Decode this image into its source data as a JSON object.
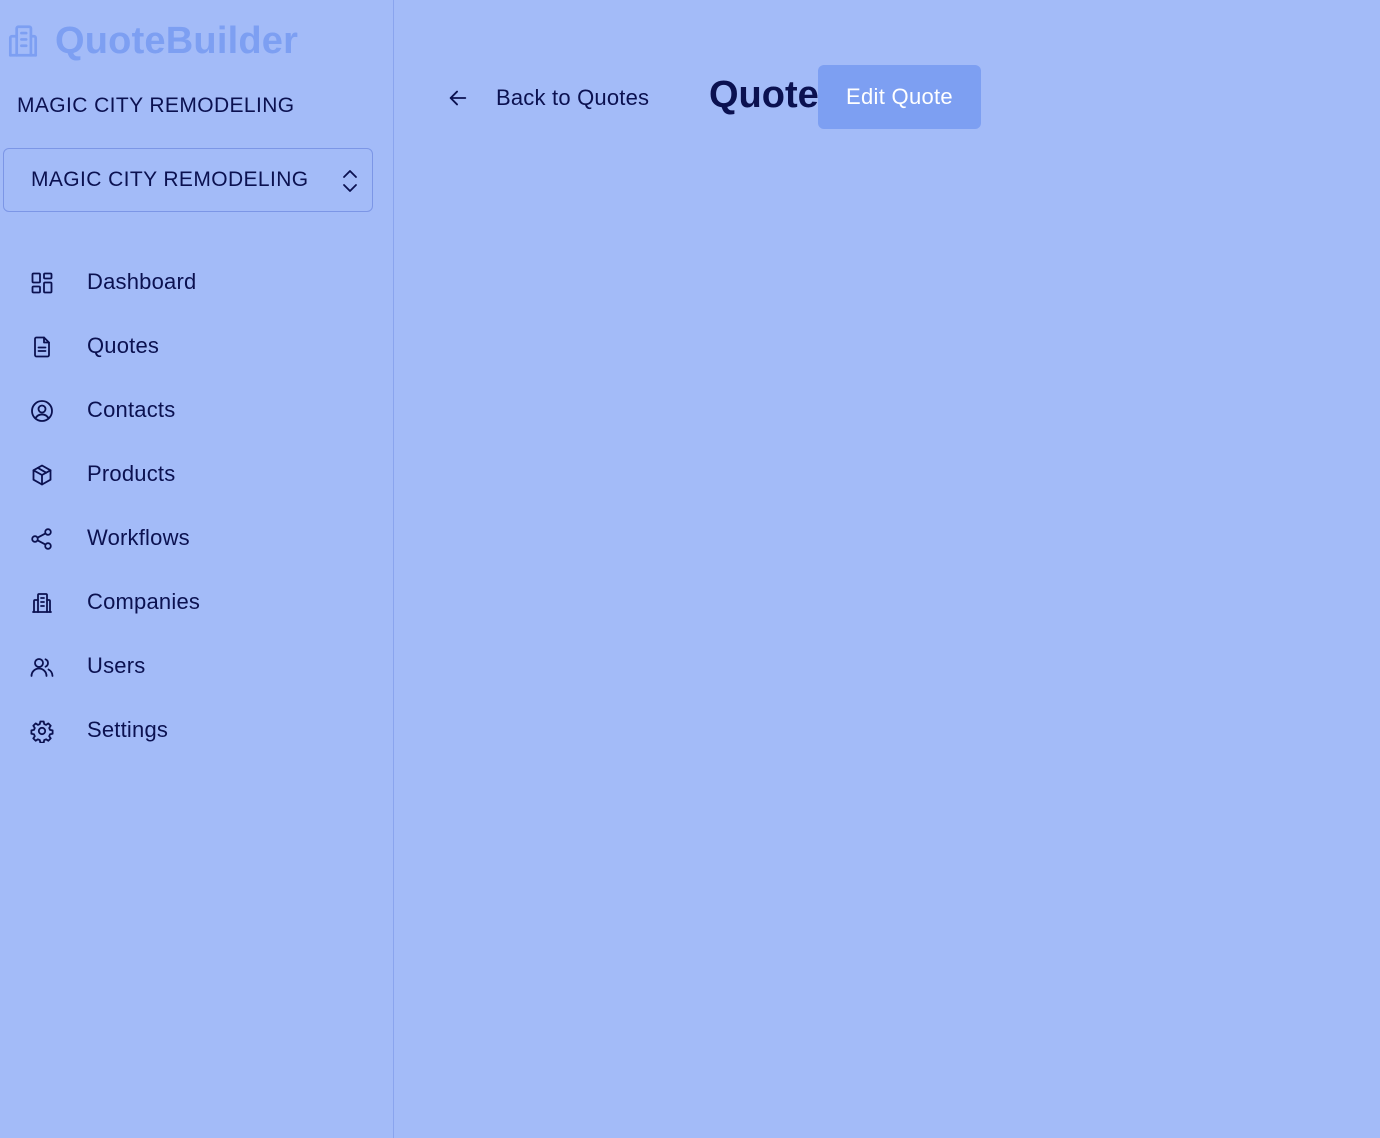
{
  "brand": {
    "name": "QuoteBuilder",
    "icon": "building-icon"
  },
  "sidebar": {
    "company_label": "MAGIC CITY REMODELING",
    "company_select": {
      "value": "MAGIC CITY REMODELING",
      "icon": "chevron-up-down-icon"
    },
    "items": [
      {
        "label": "Dashboard",
        "icon": "dashboard-icon"
      },
      {
        "label": "Quotes",
        "icon": "document-icon"
      },
      {
        "label": "Contacts",
        "icon": "user-circle-icon"
      },
      {
        "label": "Products",
        "icon": "cube-icon"
      },
      {
        "label": "Workflows",
        "icon": "share-icon"
      },
      {
        "label": "Companies",
        "icon": "building-icon"
      },
      {
        "label": "Users",
        "icon": "users-icon"
      },
      {
        "label": "Settings",
        "icon": "gear-icon"
      }
    ]
  },
  "header": {
    "back_label": "Back to Quotes",
    "back_icon": "arrow-left-icon",
    "title": "Quote",
    "edit_label": "Edit Quote"
  },
  "colors": {
    "background": "#a3bbf8",
    "accent": "#7d9ff2",
    "text": "#0b1150",
    "button_text": "#ffffff"
  }
}
